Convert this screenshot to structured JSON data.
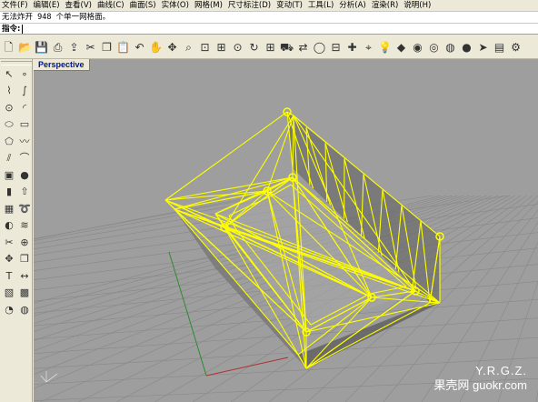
{
  "menubar": {
    "items": [
      {
        "label": "文件(F)"
      },
      {
        "label": "编辑(E)"
      },
      {
        "label": "查看(V)"
      },
      {
        "label": "曲线(C)"
      },
      {
        "label": "曲面(S)"
      },
      {
        "label": "实体(O)"
      },
      {
        "label": "网格(M)"
      },
      {
        "label": "尺寸标注(D)"
      },
      {
        "label": "变动(T)"
      },
      {
        "label": "工具(L)"
      },
      {
        "label": "分析(A)"
      },
      {
        "label": "渲染(R)"
      },
      {
        "label": "说明(H)"
      }
    ]
  },
  "command": {
    "history": "无法炸开 948 个单一网格面。",
    "prompt": "指令:",
    "value": ""
  },
  "toolbar": {
    "icons": [
      "new-icon",
      "open-icon",
      "save-icon",
      "print-icon",
      "import-icon",
      "cut-icon",
      "copy-icon",
      "paste-icon",
      "undo-icon",
      "pan-hand-icon",
      "rotate-view-icon",
      "zoom-icon",
      "zoom-window-icon",
      "zoom-extents-icon",
      "zoom-selected-icon",
      "rotate-camera-icon",
      "four-viewports-icon",
      "car-icon",
      "toggle-icon",
      "circle-icon",
      "cplane-icon",
      "snap-icon",
      "osnap-icon",
      "light-bulb-icon",
      "layer-icon",
      "material-icon",
      "color-wheel-icon",
      "render-icon",
      "sphere-icon",
      "arrow-icon",
      "properties-icon",
      "options-icon"
    ]
  },
  "sidebar": {
    "tools": [
      "select-arrow-icon",
      "point-icon",
      "polyline-icon",
      "curve-icon",
      "circle-tool-icon",
      "arc-icon",
      "ellipse-icon",
      "rectangle-icon",
      "polygon-icon",
      "freeform-icon",
      "offset-icon",
      "fillet-icon",
      "box-icon",
      "sphere-tool-icon",
      "cylinder-icon",
      "extrude-icon",
      "mesh-icon",
      "sweep-icon",
      "boolean-icon",
      "loft-icon",
      "split-icon",
      "join-icon",
      "move-icon",
      "copy-tool-icon",
      "text-icon",
      "dimension-icon",
      "group-icon",
      "block-icon",
      "analyze-icon",
      "render-tool-icon"
    ]
  },
  "viewport": {
    "label": "Perspective",
    "background": "#9e9e9e",
    "grid_color": "#888888",
    "x_axis_color": "#b03030",
    "y_axis_color": "#2f8a2f",
    "mesh_color": "#ffff00"
  },
  "watermark": {
    "line1": "Y.R.G.Z.",
    "line2": "果壳网 guokr.com"
  }
}
